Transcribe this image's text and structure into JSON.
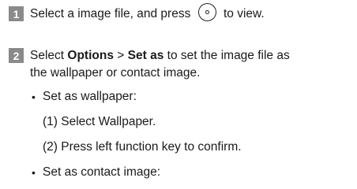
{
  "steps": [
    {
      "number": "1",
      "text_before_icon": "Select a image file, and press",
      "icon": "ok-key-icon",
      "text_after_icon": "to view."
    },
    {
      "number": "2",
      "line1_prefix": "Select",
      "options_label": "Options",
      "separator": ">",
      "set_as_label": "Set as",
      "line1_suffix": "to set the image file as",
      "line2": "the wallpaper or contact image."
    }
  ],
  "bullets": [
    {
      "label": "Set as wallpaper:",
      "substeps": [
        "(1) Select Wallpaper.",
        "(2) Press left function key to confirm."
      ]
    },
    {
      "label": "Set as contact image:"
    }
  ],
  "colors": {
    "step_badge": "#8a8a8a",
    "text": "#1a1a1a"
  }
}
